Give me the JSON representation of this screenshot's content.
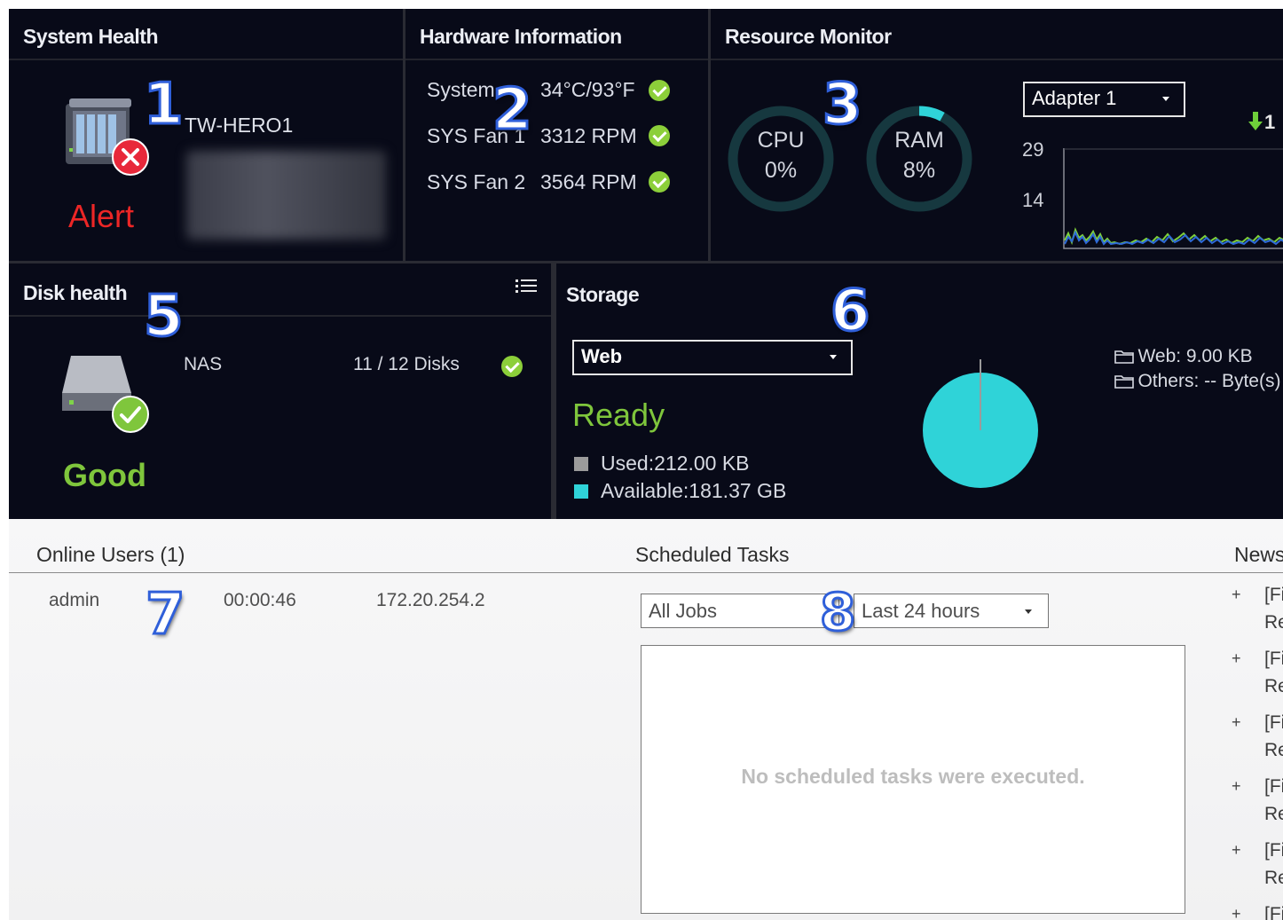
{
  "system_health": {
    "title": "System Health",
    "device_name": "TW-HERO1",
    "status": "Alert"
  },
  "hardware_info": {
    "title": "Hardware Information",
    "rows": [
      {
        "label": "System",
        "value": "34°C/93°F"
      },
      {
        "label": "SYS Fan 1",
        "value": "3312 RPM"
      },
      {
        "label": "SYS Fan 2",
        "value": "3564 RPM"
      }
    ]
  },
  "resource_monitor": {
    "title": "Resource Monitor",
    "cpu": {
      "label": "CPU",
      "value": "0%",
      "percent": 0
    },
    "ram": {
      "label": "RAM",
      "value": "8%",
      "percent": 8
    },
    "adapter": "Adapter 1",
    "ticks": [
      "29",
      "14"
    ],
    "traffic_label": "1",
    "accent": "#2fd3d8"
  },
  "disk_health": {
    "title": "Disk health",
    "source": "NAS",
    "disks": "11 / 12 Disks",
    "status": "Good"
  },
  "storage": {
    "title": "Storage",
    "volume": "Web",
    "status": "Ready",
    "used": "Used:212.00 KB",
    "available": "Available:181.37 GB",
    "legend": [
      "Web: 9.00 KB",
      "Others: -- Byte(s)"
    ],
    "used_color": "#9b9b9b",
    "available_color": "#2fd3d8"
  },
  "online_users": {
    "title": "Online Users (1)",
    "rows": [
      {
        "user": "admin",
        "duration": "00:00:46",
        "ip": "172.20.254.2"
      }
    ]
  },
  "scheduled_tasks": {
    "title": "Scheduled Tasks",
    "job_filter": "All Jobs",
    "time_filter": "Last 24 hours",
    "empty_message": "No scheduled tasks were executed."
  },
  "news": {
    "title": "News",
    "items": [
      {
        "line1": "[Fi",
        "line2": "Re"
      },
      {
        "line1": "[Fi",
        "line2": "Re"
      },
      {
        "line1": "[Fi",
        "line2": "Re"
      },
      {
        "line1": "[Fi",
        "line2": "Re"
      },
      {
        "line1": "[Fi",
        "line2": "Re"
      },
      {
        "line1": "[Fi",
        "line2": ""
      }
    ]
  },
  "callouts": [
    "1",
    "2",
    "3",
    "5",
    "6",
    "7",
    "8"
  ]
}
